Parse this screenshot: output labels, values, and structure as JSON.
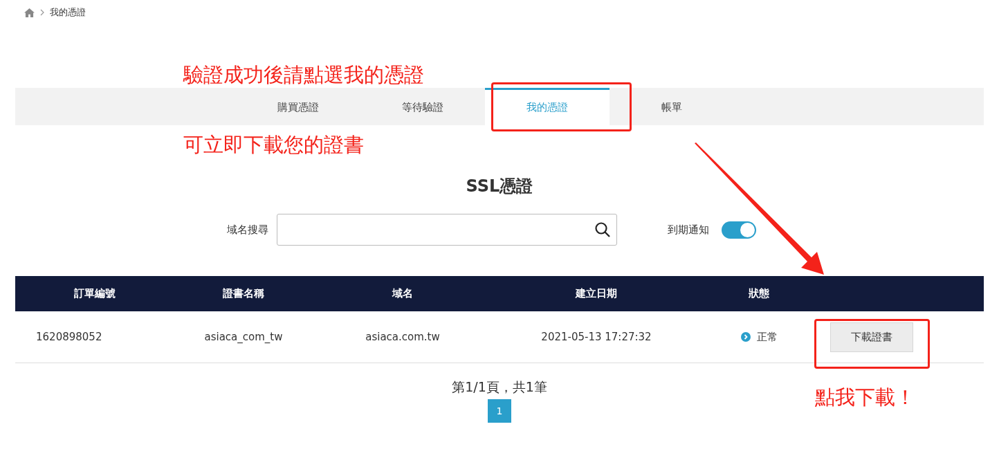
{
  "breadcrumb": {
    "items": [
      "我的憑證"
    ]
  },
  "annotations": [
    {
      "kind": "note",
      "text": "驗證成功後請點選我的憑證"
    },
    {
      "kind": "note",
      "text": "可立即下載您的證書"
    },
    {
      "kind": "note",
      "text": "點我下載！"
    }
  ],
  "tabs": [
    {
      "label": "購買憑證",
      "selected": false
    },
    {
      "label": "等待驗證",
      "selected": false
    },
    {
      "label": "我的憑證",
      "selected": true
    },
    {
      "label": "帳單",
      "selected": false
    }
  ],
  "title": "SSL憑證",
  "search": {
    "label": "域名搜尋"
  },
  "notify": {
    "label": "到期通知",
    "on": true
  },
  "table": {
    "columns": [
      "訂單編號",
      "證書名稱",
      "域名",
      "建立日期",
      "狀態"
    ],
    "rows": [
      {
        "order": "1620898052",
        "name": "asiaca_com_tw",
        "domain": "asiaca.com.tw",
        "created": "2021-05-13 17:27:32",
        "status": "正常",
        "action": "下載證書"
      }
    ]
  },
  "pagination": {
    "summary": "第1/1頁，共1筆",
    "pages": [
      {
        "label": "1",
        "selected": true
      }
    ]
  }
}
